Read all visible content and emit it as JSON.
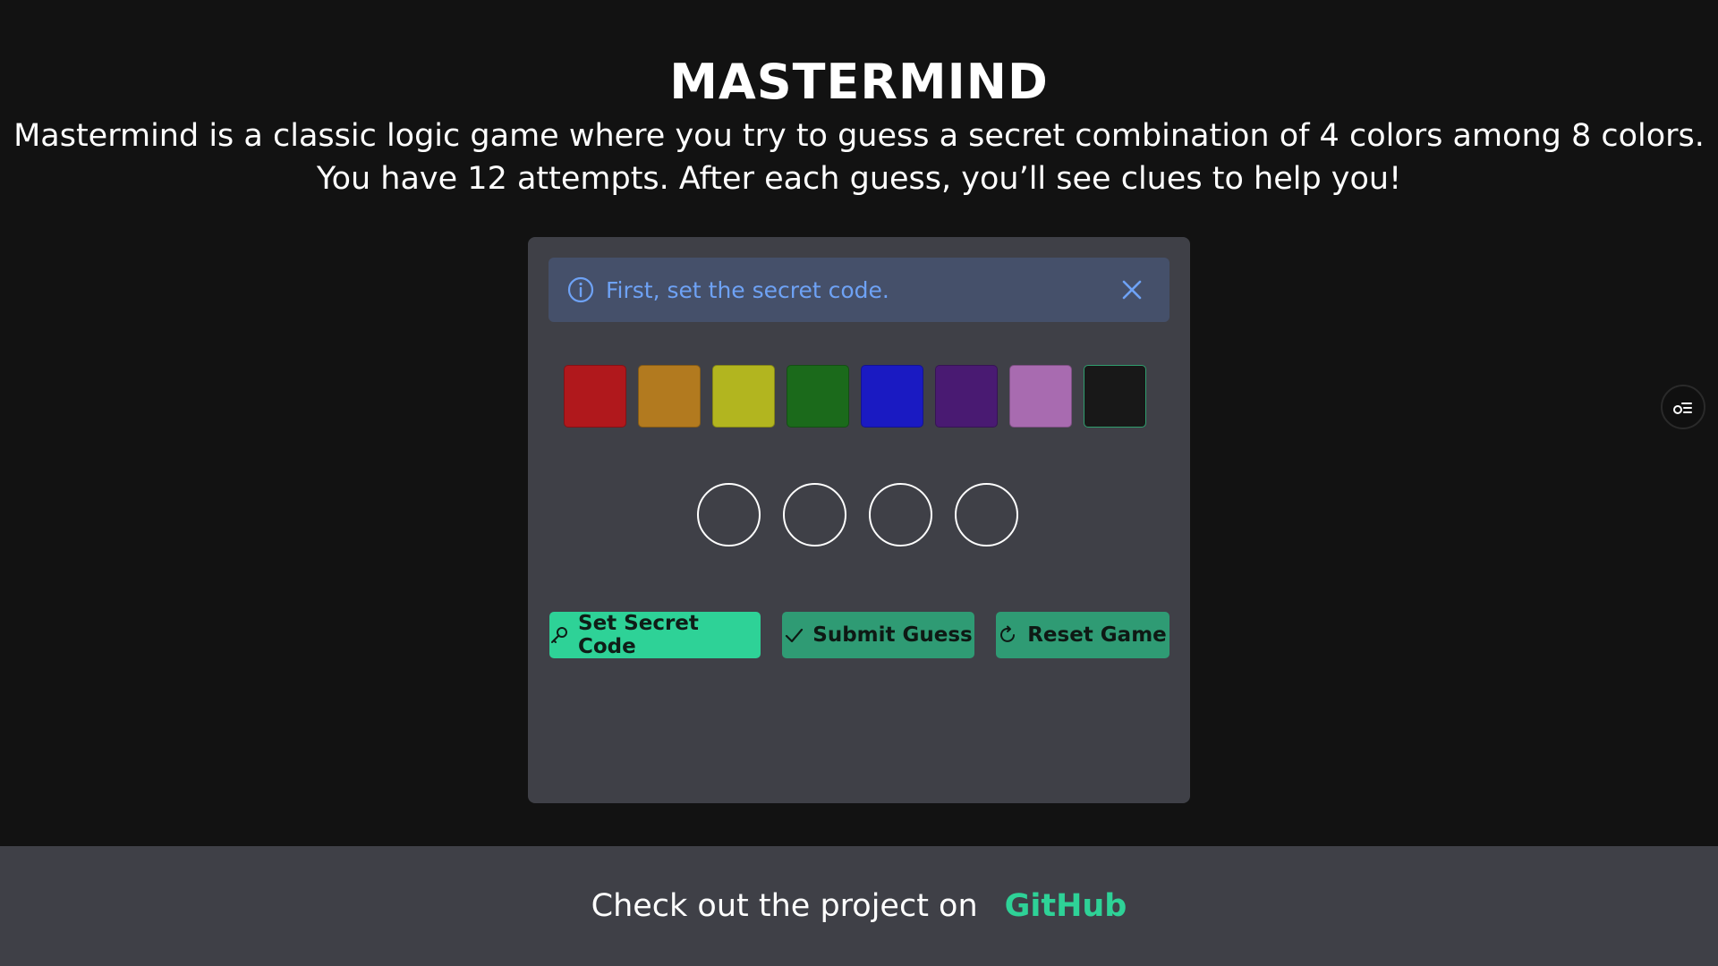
{
  "header": {
    "title": "MASTERMIND",
    "description": "Mastermind is a classic logic game where you try to guess a secret combination of 4 colors among 8 colors. You have 12 attempts. After each guess, you’ll see clues to help you!"
  },
  "alert": {
    "message": "First, set the secret code.",
    "icon": "info-icon",
    "close_icon": "close-icon",
    "color": "#6ea2f5"
  },
  "palette": {
    "colors": [
      "#b0181c",
      "#b27a1f",
      "#b2b51f",
      "#1b6a1b",
      "#1a1ac2",
      "#491a72",
      "#a86bb0",
      "#181818"
    ]
  },
  "slots": {
    "count": 4
  },
  "actions": {
    "set_secret_code": "Set Secret Code",
    "submit_guess": "Submit Guess",
    "reset_game": "Reset Game"
  },
  "colors": {
    "accent": "#2ed297",
    "accent_dim": "#2f9b74",
    "panel": "#3f4047",
    "background": "#121212"
  },
  "footer": {
    "text": "Check out the project on",
    "link_label": "GitHub"
  }
}
